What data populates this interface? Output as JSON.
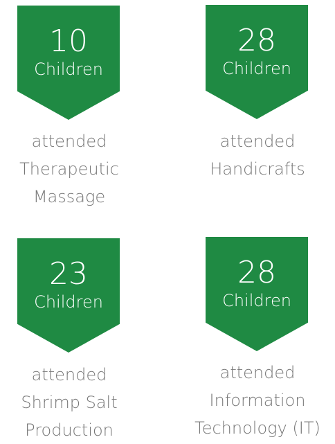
{
  "colors": {
    "badge_green": "#1f8a43",
    "caption_gray": "#777777"
  },
  "stats": [
    {
      "number": "10",
      "unit": "Children",
      "caption_lines": [
        "attended",
        "Therapeutic",
        "Massage"
      ]
    },
    {
      "number": "28",
      "unit": "Children",
      "caption_lines": [
        "attended",
        "Handicrafts"
      ]
    },
    {
      "number": "23",
      "unit": "Children",
      "caption_lines": [
        "attended",
        "Shrimp Salt",
        "Production"
      ]
    },
    {
      "number": "28",
      "unit": "Children",
      "caption_lines": [
        "attended",
        "Information",
        "Technology (IT)"
      ]
    }
  ]
}
